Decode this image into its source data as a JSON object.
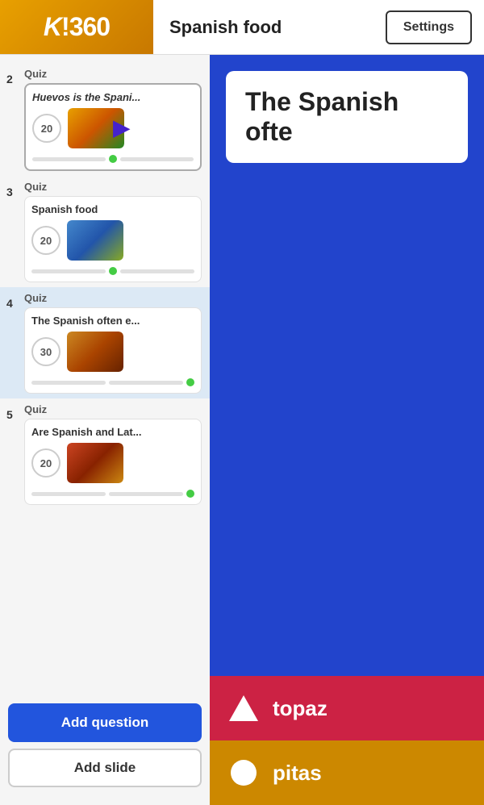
{
  "header": {
    "logo": "K!360",
    "title": "Spanish food",
    "settings_label": "Settings"
  },
  "sidebar": {
    "items": [
      {
        "number": "2",
        "type": "Quiz",
        "title": "Huevos is the Spani...",
        "italic": true,
        "points": "20",
        "highlighted": true,
        "has_cursor": true
      },
      {
        "number": "3",
        "type": "Quiz",
        "title": "Spanish food",
        "italic": false,
        "points": "20",
        "highlighted": false
      },
      {
        "number": "4",
        "type": "Quiz",
        "title": "The Spanish often e...",
        "italic": false,
        "points": "30",
        "highlighted": false,
        "active": true
      },
      {
        "number": "5",
        "type": "Quiz",
        "title": "Are Spanish and Lat...",
        "italic": false,
        "points": "20",
        "highlighted": false
      }
    ],
    "add_question_label": "Add question",
    "add_slide_label": "Add slide"
  },
  "preview": {
    "question_text": "The Spanish ofte",
    "answers": [
      {
        "shape": "triangle",
        "text": "topaz",
        "color": "red"
      },
      {
        "shape": "circle",
        "text": "pitas",
        "color": "gold"
      }
    ]
  }
}
